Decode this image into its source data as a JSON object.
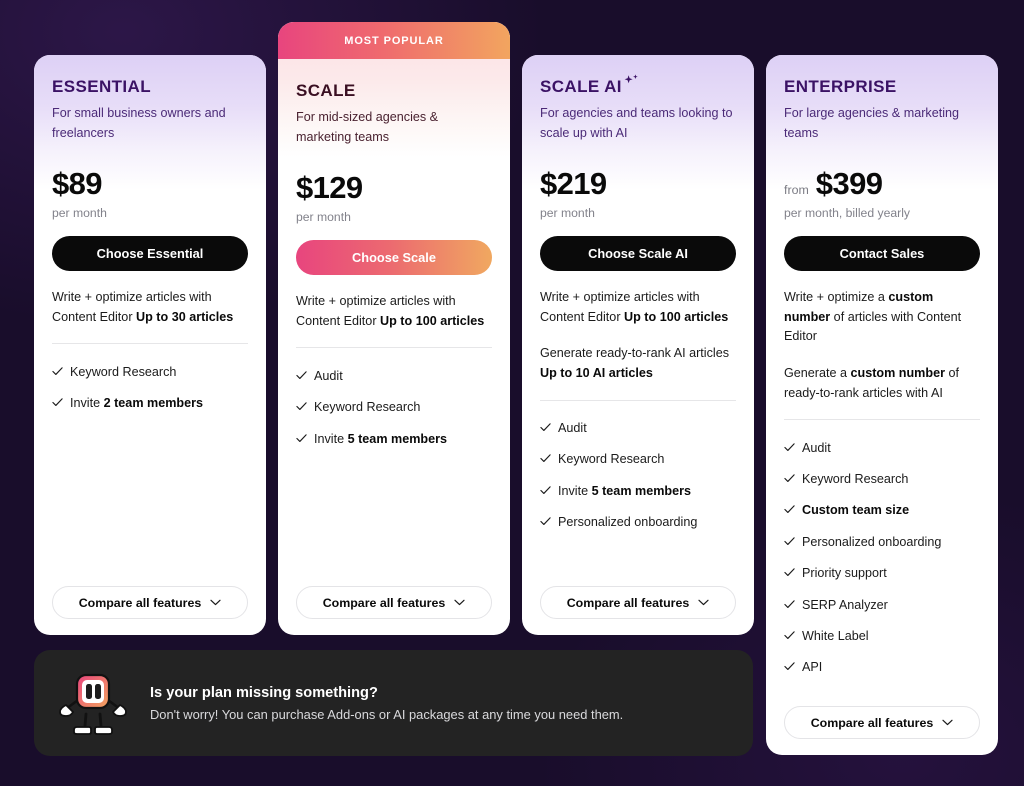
{
  "theme": {
    "background": "#190d2b",
    "card_bg": "#ffffff",
    "accent_pink": "#e8457e",
    "accent_orange": "#f0a860",
    "purple_heading": "#3b1265",
    "dark_button": "#0a0a0a",
    "banner_bg": "#232323"
  },
  "plans": [
    {
      "id": "essential",
      "name": "ESSENTIAL",
      "badge": null,
      "description": "For small business owners and freelancers",
      "price_prefix": "",
      "price": "$89",
      "price_note": "per month",
      "cta_label": "Choose Essential",
      "blocks": [
        {
          "text_before": "Write + optimize articles with Content Editor ",
          "bold": "Up to 30 articles",
          "text_after": ""
        }
      ],
      "features": [
        {
          "label": "Keyword Research",
          "bold_part": "",
          "all_bold": false
        },
        {
          "label": "Invite ",
          "bold_part": "2 team members",
          "all_bold": false
        }
      ],
      "compare_label": "Compare all features"
    },
    {
      "id": "scale",
      "name": "SCALE",
      "badge": "MOST POPULAR",
      "description": "For mid-sized agencies & marketing teams",
      "price_prefix": "",
      "price": "$129",
      "price_note": "per month",
      "cta_label": "Choose Scale",
      "blocks": [
        {
          "text_before": "Write + optimize articles with Content Editor ",
          "bold": "Up to 100 articles",
          "text_after": ""
        }
      ],
      "features": [
        {
          "label": "Audit",
          "bold_part": "",
          "all_bold": false
        },
        {
          "label": "Keyword Research",
          "bold_part": "",
          "all_bold": false
        },
        {
          "label": "Invite ",
          "bold_part": "5 team members",
          "all_bold": false
        }
      ],
      "compare_label": "Compare all features"
    },
    {
      "id": "scaleai",
      "name": "SCALE AI",
      "name_icon": "sparkles-icon",
      "badge": null,
      "description": "For agencies and teams looking to scale up with AI",
      "price_prefix": "",
      "price": "$219",
      "price_note": "per month",
      "cta_label": "Choose Scale AI",
      "blocks": [
        {
          "text_before": "Write + optimize articles with Content Editor ",
          "bold": "Up to 100 articles",
          "text_after": ""
        },
        {
          "text_before": "Generate ready-to-rank AI articles ",
          "bold": "Up to 10 AI articles",
          "text_after": ""
        }
      ],
      "features": [
        {
          "label": "Audit",
          "bold_part": "",
          "all_bold": false
        },
        {
          "label": "Keyword Research",
          "bold_part": "",
          "all_bold": false
        },
        {
          "label": "Invite ",
          "bold_part": "5 team members",
          "all_bold": false
        },
        {
          "label": "Personalized onboarding",
          "bold_part": "",
          "all_bold": false
        }
      ],
      "compare_label": "Compare all features"
    },
    {
      "id": "enterprise",
      "name": "ENTERPRISE",
      "badge": null,
      "description": "For large agencies & marketing teams",
      "price_prefix": "from",
      "price": "$399",
      "price_note": "per month, billed yearly",
      "cta_label": "Contact Sales",
      "blocks": [
        {
          "text_before": "Write + optimize a ",
          "bold": "custom number",
          "text_after": " of articles with Content Editor"
        },
        {
          "text_before": "Generate a ",
          "bold": "custom number",
          "text_after": " of ready-to-rank articles with AI"
        }
      ],
      "features": [
        {
          "label": "Audit",
          "bold_part": "",
          "all_bold": false
        },
        {
          "label": "Keyword Research",
          "bold_part": "",
          "all_bold": false
        },
        {
          "label": "Custom team size",
          "bold_part": "",
          "all_bold": true
        },
        {
          "label": "Personalized onboarding",
          "bold_part": "",
          "all_bold": false
        },
        {
          "label": "Priority support",
          "bold_part": "",
          "all_bold": false
        },
        {
          "label": "SERP Analyzer",
          "bold_part": "",
          "all_bold": false
        },
        {
          "label": "White Label",
          "bold_part": "",
          "all_bold": false
        },
        {
          "label": "API",
          "bold_part": "",
          "all_bold": false
        }
      ],
      "compare_label": "Compare all features"
    }
  ],
  "addon_banner": {
    "title": "Is your plan missing something?",
    "subtitle": "Don't worry! You can purchase Add-ons or AI packages at any time you need them.",
    "mascot_icon": "robot-mascot-icon"
  }
}
